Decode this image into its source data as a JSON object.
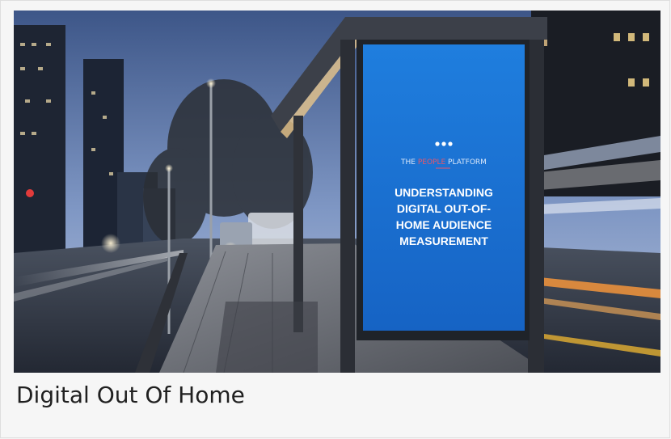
{
  "card": {
    "caption": "Digital Out Of Home"
  },
  "billboard": {
    "brand_first": "THE ",
    "brand_highlight": "PEOPLE",
    "brand_last": " PLATFORM",
    "headline_lines": [
      "UNDERSTANDING",
      "DIGITAL OUT-OF-",
      "HOME AUDIENCE",
      "MEASUREMENT"
    ]
  },
  "colors": {
    "screen_blue": "#1a74d4",
    "sky_top": "#3f5a8c",
    "sky_bottom": "#9db2d6",
    "caption_text": "#202020"
  }
}
